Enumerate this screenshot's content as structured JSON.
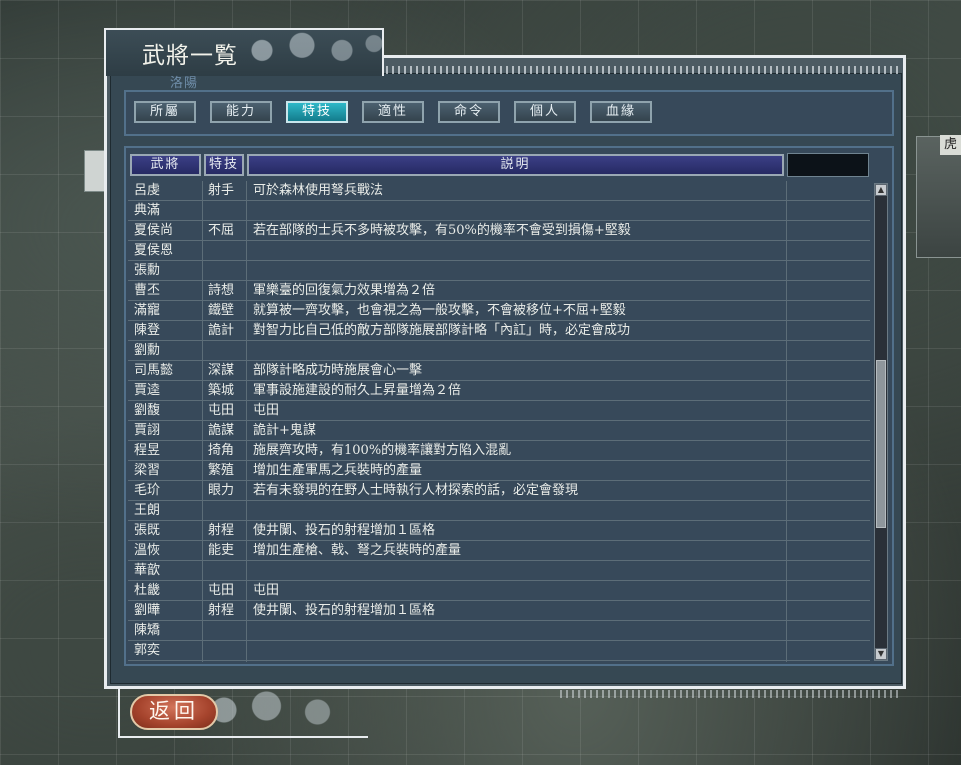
{
  "window": {
    "title": "武將一覧",
    "subtitle": "洛陽"
  },
  "tabs": [
    {
      "label": "所屬",
      "active": false
    },
    {
      "label": "能力",
      "active": false
    },
    {
      "label": "特技",
      "active": true
    },
    {
      "label": "適性",
      "active": false
    },
    {
      "label": "命令",
      "active": false
    },
    {
      "label": "個人",
      "active": false
    },
    {
      "label": "血緣",
      "active": false
    }
  ],
  "table": {
    "headers": {
      "name": "武將",
      "skill": "特技",
      "desc": "説明"
    },
    "rows": [
      {
        "name": "呂虔",
        "skill": "射手",
        "desc": "可於森林使用弩兵戰法"
      },
      {
        "name": "典滿",
        "skill": "",
        "desc": ""
      },
      {
        "name": "夏侯尚",
        "skill": "不屈",
        "desc": "若在部隊的士兵不多時被攻擊，有50%的機率不會受到損傷+堅毅"
      },
      {
        "name": "夏侯恩",
        "skill": "",
        "desc": ""
      },
      {
        "name": "張勳",
        "skill": "",
        "desc": ""
      },
      {
        "name": "曹丕",
        "skill": "詩想",
        "desc": "軍樂臺的回復氣力效果增為２倍"
      },
      {
        "name": "滿寵",
        "skill": "鐵壁",
        "desc": "就算被一齊攻擊，也會視之為一般攻擊，不會被移位+不屈+堅毅"
      },
      {
        "name": "陳登",
        "skill": "詭計",
        "desc": "對智力比自己低的敵方部隊施展部隊計略「內訌」時，必定會成功"
      },
      {
        "name": "劉勳",
        "skill": "",
        "desc": ""
      },
      {
        "name": "司馬懿",
        "skill": "深謀",
        "desc": "部隊計略成功時施展會心一擊"
      },
      {
        "name": "賈逵",
        "skill": "築城",
        "desc": "軍事設施建設的耐久上昇量增為２倍"
      },
      {
        "name": "劉馥",
        "skill": "屯田",
        "desc": "屯田"
      },
      {
        "name": "賈詡",
        "skill": "詭謀",
        "desc": "詭計+鬼謀"
      },
      {
        "name": "程昱",
        "skill": "掎角",
        "desc": "施展齊攻時，有100%的機率讓對方陷入混亂"
      },
      {
        "name": "梁習",
        "skill": "繁殖",
        "desc": "增加生產軍馬之兵裝時的產量"
      },
      {
        "name": "毛玠",
        "skill": "眼力",
        "desc": "若有未發現的在野人士時執行人材探索的話，必定會發現"
      },
      {
        "name": "王朗",
        "skill": "",
        "desc": ""
      },
      {
        "name": "張既",
        "skill": "射程",
        "desc": "使井闌、投石的射程增加１區格"
      },
      {
        "name": "溫恢",
        "skill": "能吏",
        "desc": "增加生產槍、戟、弩之兵裝時的產量"
      },
      {
        "name": "華歆",
        "skill": "",
        "desc": ""
      },
      {
        "name": "杜畿",
        "skill": "屯田",
        "desc": "屯田"
      },
      {
        "name": "劉曄",
        "skill": "射程",
        "desc": "使井闌、投石的射程增加１區格"
      },
      {
        "name": "陳矯",
        "skill": "",
        "desc": ""
      },
      {
        "name": "郭奕",
        "skill": "",
        "desc": ""
      }
    ]
  },
  "footer": {
    "back_label": "返回"
  },
  "map": {
    "city_label": "虎"
  },
  "colors": {
    "active_tab": "#1fa0b0",
    "header_bg": "#2f3375",
    "back_button": "#a6442d"
  }
}
